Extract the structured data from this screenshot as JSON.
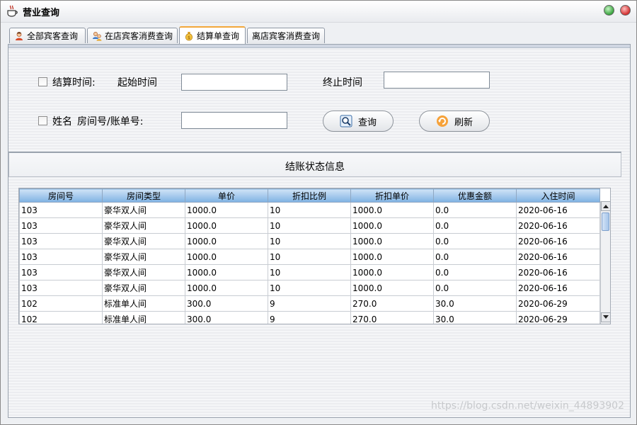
{
  "window": {
    "title": "营业查询"
  },
  "tabs": [
    {
      "label": "全部宾客查询",
      "icon": "person-icon"
    },
    {
      "label": "在店宾客消费查询",
      "icon": "people-icon"
    },
    {
      "label": "结算单查询",
      "icon": "money-bag-icon",
      "active": true
    },
    {
      "label": "离店宾客消费查询",
      "icon": "none"
    }
  ],
  "form": {
    "settle_time_label": "结算时间:",
    "start_label": "起始时间",
    "end_label": "终止时间",
    "start_value": "",
    "end_value": "",
    "name_label": "姓名",
    "room_label": "房间号/账单号:",
    "room_value": "",
    "query_label": "查询",
    "refresh_label": "刷新"
  },
  "section": {
    "title": "结账状态信息"
  },
  "table": {
    "columns": [
      "房间号",
      "房间类型",
      "单价",
      "折扣比例",
      "折扣单价",
      "优惠金额",
      "入住时间"
    ],
    "rows": [
      [
        "103",
        "豪华双人间",
        "1000.0",
        "10",
        "1000.0",
        "0.0",
        "2020-06-16"
      ],
      [
        "103",
        "豪华双人间",
        "1000.0",
        "10",
        "1000.0",
        "0.0",
        "2020-06-16"
      ],
      [
        "103",
        "豪华双人间",
        "1000.0",
        "10",
        "1000.0",
        "0.0",
        "2020-06-16"
      ],
      [
        "103",
        "豪华双人间",
        "1000.0",
        "10",
        "1000.0",
        "0.0",
        "2020-06-16"
      ],
      [
        "103",
        "豪华双人间",
        "1000.0",
        "10",
        "1000.0",
        "0.0",
        "2020-06-16"
      ],
      [
        "103",
        "豪华双人间",
        "1000.0",
        "10",
        "1000.0",
        "0.0",
        "2020-06-16"
      ],
      [
        "102",
        "标准单人间",
        "300.0",
        "9",
        "270.0",
        "30.0",
        "2020-06-29"
      ],
      [
        "102",
        "标准单人间",
        "300.0",
        "9",
        "270.0",
        "30.0",
        "2020-06-29"
      ]
    ]
  },
  "watermark": "https://blog.csdn.net/weixin_44893902",
  "colors": {
    "tab_accent": "#f2a73a",
    "header_blue": "#7fb2e3"
  }
}
